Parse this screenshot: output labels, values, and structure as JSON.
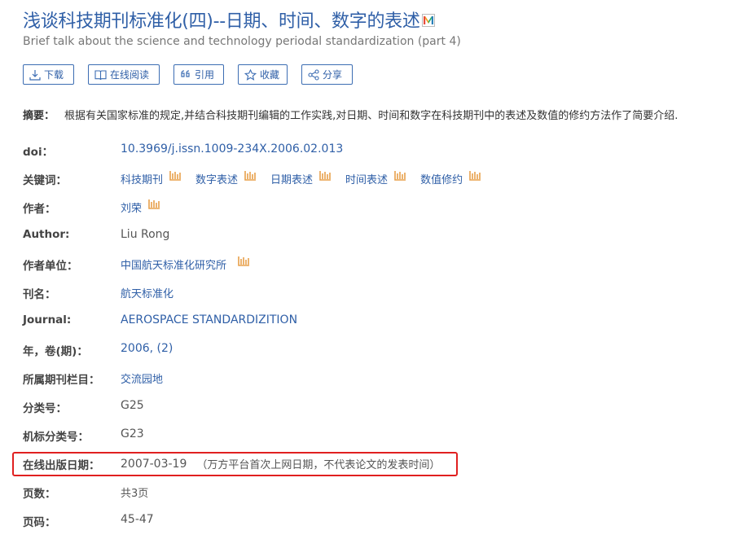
{
  "article": {
    "title": "浅谈科技期刊标准化(四)--日期、时间、数字的表述",
    "subtitle": "Brief talk about the science and technology periodal standardization (part 4)"
  },
  "actions": {
    "download": "下载",
    "read_online": "在线阅读",
    "cite": "引用",
    "favorite": "收藏",
    "share": "分享"
  },
  "abstract": {
    "label": "摘要：",
    "text": "根据有关国家标准的规定,并结合科技期刊编辑的工作实践,对日期、时间和数字在科技期刊中的表述及数值的修约方法作了简要介绍."
  },
  "fields": {
    "doi": {
      "label": "doi：",
      "value": "10.3969/j.issn.1009-234X.2006.02.013"
    },
    "keywords": {
      "label": "关键词：",
      "items": [
        "科技期刊",
        "数字表述",
        "日期表述",
        "时间表述",
        "数值修约"
      ]
    },
    "author": {
      "label": "作者：",
      "value": "刘荣"
    },
    "author_en": {
      "label": "Author:",
      "value": "Liu Rong"
    },
    "affiliation": {
      "label": "作者单位：",
      "value": "中国航天标准化研究所"
    },
    "journal": {
      "label": "刊名：",
      "value": "航天标准化"
    },
    "journal_en": {
      "label": "Journal:",
      "value": "AEROSPACE STANDARDIZITION"
    },
    "year_issue": {
      "label": "年，卷(期)：",
      "value": "2006, (2)"
    },
    "column": {
      "label": "所属期刊栏目：",
      "value": "交流园地"
    },
    "classification": {
      "label": "分类号：",
      "value": "G25"
    },
    "machine_classification": {
      "label": "机标分类号：",
      "value": "G23"
    },
    "online_date": {
      "label": "在线出版日期：",
      "value": "2007-03-19",
      "note": "（万方平台首次上网日期，不代表论文的发表时间）"
    },
    "pages_count": {
      "label": "页数：",
      "value": "共3页"
    },
    "page_range": {
      "label": "页码：",
      "value": "45-47"
    }
  },
  "colors": {
    "link": "#2f5fa7",
    "accent_icon": "#e8a04a",
    "highlight": "#e02020"
  }
}
